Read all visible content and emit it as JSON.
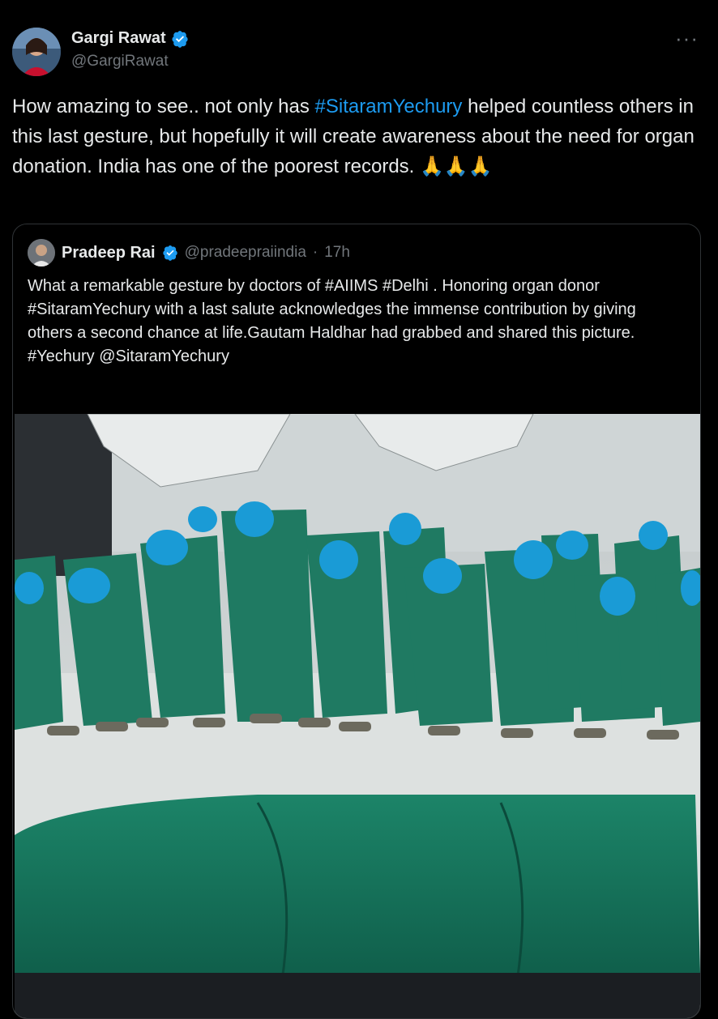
{
  "author": {
    "name": "Gargi Rawat",
    "handle": "@GargiRawat",
    "verified_color": "#1d9bf0"
  },
  "more_icon": "more-horizontal-icon",
  "tweet": {
    "text_parts": [
      "How amazing to see.. not only has ",
      "#SitaramYechury",
      " helped countless others in this last gesture, but hopefully it will create awareness about the need for organ donation. India has one of the poorest records. ",
      "🙏🙏🙏"
    ]
  },
  "quote": {
    "name": "Pradeep Rai",
    "handle": "@pradeepraiindia",
    "separator": "·",
    "time": "17h",
    "lines": [
      "What a remarkable gesture by doctors of #AIIMS #Delhi . Honoring organ donor #SitaramYechury with a last salute acknowledges the immense contribution by giving others a second chance at life.Gautam Haldhar had grabbed and shared this picture.",
      "#Yechury @SitaramYechury"
    ]
  },
  "colors": {
    "accent": "#1d9bf0",
    "background": "#000000",
    "text": "#e7e9ea",
    "muted": "#71767b",
    "scrubs": "#1f7a62"
  }
}
